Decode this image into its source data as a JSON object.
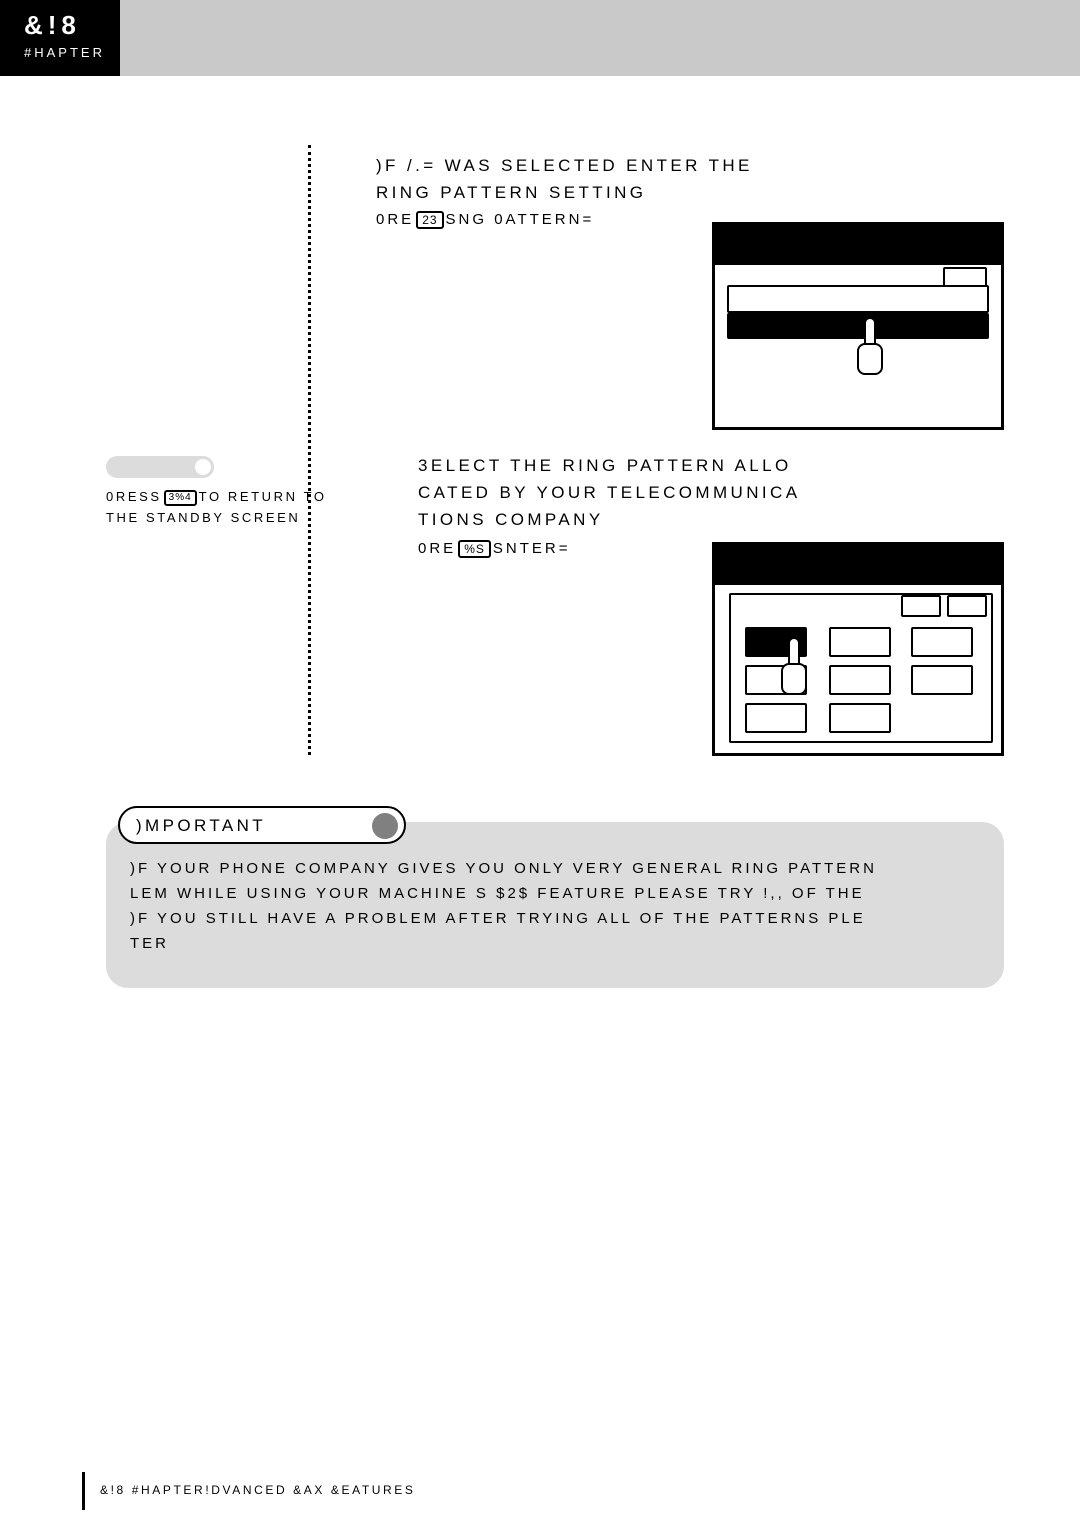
{
  "header": {
    "fax_label": "&!8",
    "chapter_label": "#HAPTER"
  },
  "steps": [
    {
      "id": "step-1",
      "text_lines": [
        ")F /.= WAS SELECTED  ENTER THE",
        "RING PATTERN SETTING"
      ],
      "press_prefix": "0RE",
      "press_key": "23",
      "press_suffix": "SNG 0ATTERN="
    },
    {
      "id": "step-2",
      "text_lines": [
        "3ELECT THE RING PATTERN ALLO",
        "CATED BY YOUR TELECOMMUNICA",
        "TIONS COMPANY"
      ],
      "press_prefix": "0RE",
      "press_key": "%S",
      "press_suffix": "SNTER="
    }
  ],
  "sidenote": {
    "prefix": "0RESS",
    "key": "3%4",
    "suffix": "TO RETURN TO",
    "line2": "THE STANDBY SCREEN"
  },
  "important": {
    "tab_label": ")MPORTANT",
    "lines": [
      ")F YOUR PHONE COMPANY GIVES YOU ONLY VERY GENERAL RING PATTERN",
      "LEM WHILE USING YOUR MACHINE S $2$ FEATURE  PLEASE TRY !,, OF THE",
      ")F YOU STILL HAVE A PROBLEM AFTER TRYING ALL OF THE PATTERNS  PLE",
      "TER"
    ]
  },
  "footer": {
    "text_a": "&!8",
    "text_b": "#HAPTER",
    "text_c": "!DVANCED &AX &EATURES"
  },
  "panels": [
    {
      "id": "panel-1",
      "name": "ring-pattern-setting-screen"
    },
    {
      "id": "panel-2",
      "name": "ring-pattern-selection-screen"
    }
  ]
}
